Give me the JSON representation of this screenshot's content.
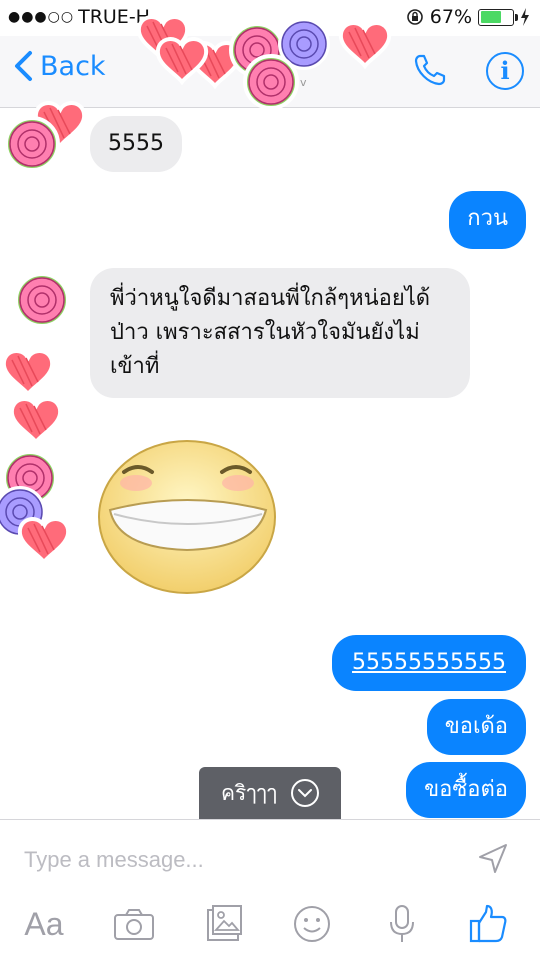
{
  "status_bar": {
    "signal_dots": "●●●○○",
    "carrier": "TRUE-H",
    "battery_text": "67%",
    "battery_level": 0.67
  },
  "nav": {
    "back_label": "Back",
    "subtitle": "v"
  },
  "messages": [
    {
      "direction": "in",
      "text": "5555"
    },
    {
      "direction": "out",
      "text": "กวน"
    },
    {
      "direction": "in",
      "text": "พี่ว่าหนูใจดีมาสอนพี่ใกล้ๆหน่อยได้ป่าว เพราะสสารในหัวใจมันยังไม่เข้าที่"
    },
    {
      "direction": "in",
      "sticker": "grinning-face-sticker"
    },
    {
      "direction": "out",
      "text": "55555555555"
    },
    {
      "direction": "out",
      "text": "ขอเด้อ"
    },
    {
      "direction": "out",
      "text": "ขอซื้อต่อ"
    }
  ],
  "suggestion": {
    "label": "คริๅๅๅ"
  },
  "composer": {
    "placeholder": "Type a message...",
    "toolbar_icons": [
      "text-format-icon",
      "camera-icon",
      "photo-icon",
      "emoji-icon",
      "microphone-icon",
      "thumbs-up-icon"
    ],
    "text_format_label": "Aa"
  },
  "colors": {
    "accent": "#0a84ff",
    "incoming_bubble": "#ececee",
    "battery": "#4cd964"
  }
}
